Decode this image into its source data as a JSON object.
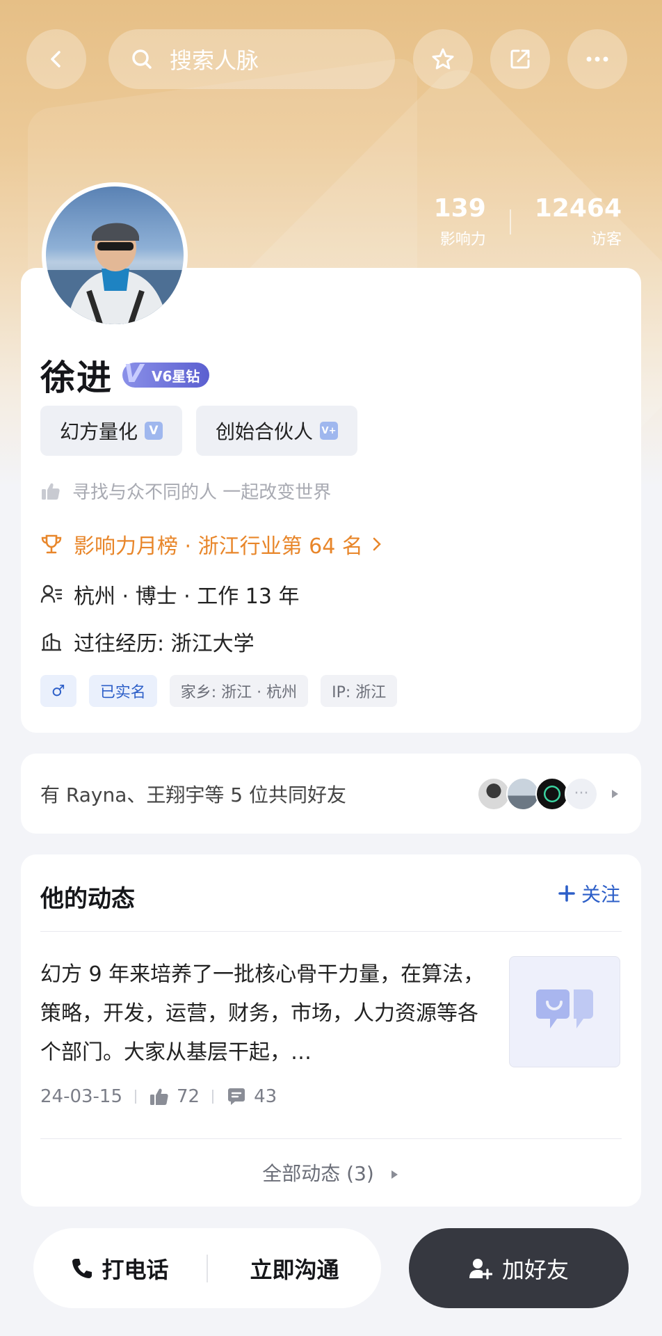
{
  "header": {
    "search_placeholder": "搜索人脉"
  },
  "stats": {
    "influence_value": "139",
    "influence_label": "影响力",
    "visitors_value": "12464",
    "visitors_label": "访客"
  },
  "profile": {
    "name": "徐进",
    "vip_label": "V6星钻",
    "tags": [
      "幻方量化",
      "创始合伙人"
    ],
    "tag_badges": [
      "V",
      "V+"
    ],
    "motto": "寻找与众不同的人 一起改变世界",
    "rank": "影响力月榜 · 浙江行业第 64 名",
    "info_basic": "杭州 · 博士 · 工作 13 年",
    "info_history": "过往经历: 浙江大学",
    "chips": {
      "gender": "♂",
      "verified": "已实名",
      "hometown": "家乡: 浙江 · 杭州",
      "ip": "IP: 浙江"
    }
  },
  "friends": {
    "text": "有 Rayna、王翔宇等 5 位共同好友",
    "more": "···"
  },
  "feed": {
    "title": "他的动态",
    "follow_label": "关注",
    "post_text": "幻方 9 年来培养了一批核心骨干力量，在算法，策略，开发，运营，财务，市场，人力资源等各个部门。大家从基层干起，…",
    "date": "24-03-15",
    "likes": "72",
    "comments": "43",
    "all_label": "全部动态 (3)"
  },
  "actions": {
    "call": "打电话",
    "chat": "立即沟通",
    "add_friend": "加好友"
  },
  "colors": {
    "accent_blue": "#2d5fc8",
    "rank_orange": "#e8862a",
    "dark_button": "#363840"
  }
}
